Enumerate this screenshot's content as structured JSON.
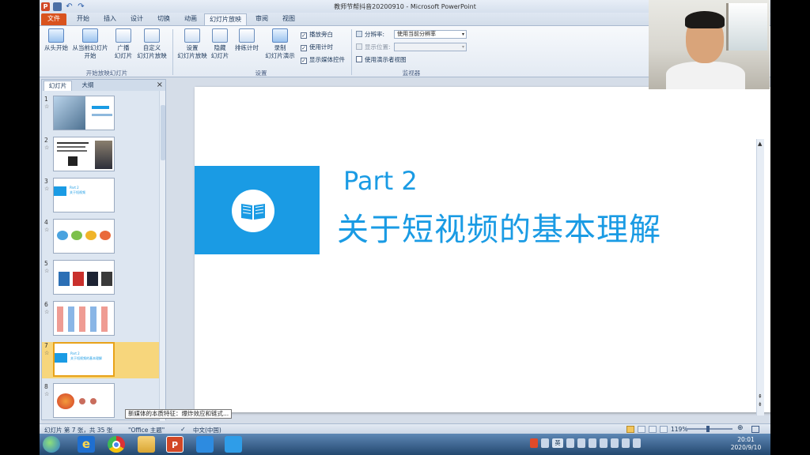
{
  "window": {
    "title": "教师节帮抖音20200910 - Microsoft PowerPoint",
    "ppt_logo": "P"
  },
  "tabs": [
    "文件",
    "开始",
    "插入",
    "设计",
    "切换",
    "动画",
    "幻灯片放映",
    "审阅",
    "视图"
  ],
  "ribbon": {
    "start_group": {
      "from_beginning": "从头开始",
      "from_current_1": "从当前幻灯片",
      "from_current_2": "开始",
      "broadcast_1": "广播",
      "broadcast_2": "幻灯片",
      "custom_1": "自定义",
      "custom_2": "幻灯片放映",
      "label": "开始放映幻灯片"
    },
    "setup_group": {
      "setup_1": "设置",
      "setup_2": "幻灯片放映",
      "hide_1": "隐藏",
      "hide_2": "幻灯片",
      "rehearse": "排练计时",
      "record_1": "录制",
      "record_2": "幻灯片演示",
      "play_narrations": "播放旁白",
      "use_timings": "使用计时",
      "show_media_controls": "显示媒体控件",
      "label": "设置"
    },
    "monitor_group": {
      "resolution_label": "分辨率:",
      "resolution_value": "使用当前分辨率",
      "show_on_label": "显示位置:",
      "presenter_view": "使用演示者视图",
      "label": "监视器"
    }
  },
  "pane": {
    "tab_slides": "幻灯片",
    "tab_outline": "大纲",
    "close": "×"
  },
  "thumbnails": [
    {
      "num": "1",
      "star": "☆"
    },
    {
      "num": "2",
      "star": "☆"
    },
    {
      "num": "3",
      "star": "☆"
    },
    {
      "num": "4",
      "star": "☆"
    },
    {
      "num": "5",
      "star": "☆"
    },
    {
      "num": "6",
      "star": "☆"
    },
    {
      "num": "7",
      "star": "☆"
    },
    {
      "num": "8",
      "star": "☆"
    }
  ],
  "thumb3_text": {
    "part": "Part 2",
    "title": "关于短视频"
  },
  "thumb7_text": {
    "part": "Part 2",
    "title": "关于短视频的基本理解"
  },
  "slide": {
    "part_title": "Part 2",
    "heading": "关于短视频的基本理解"
  },
  "tooltip": "新媒体的本质特征：爆炸效应和链式...",
  "statusbar": {
    "slide_count": "幻灯片 第 7 张，共 35 张",
    "theme": "\"Office 主题\"",
    "language": "中文(中国)",
    "zoom": "119%"
  },
  "tray": {
    "lang": "英",
    "time": "20:01",
    "date": "2020/9/10"
  },
  "colors": {
    "accent": "#1a9be4",
    "file_tab": "#d9531e",
    "selected_thumb": "#f7d67c"
  }
}
